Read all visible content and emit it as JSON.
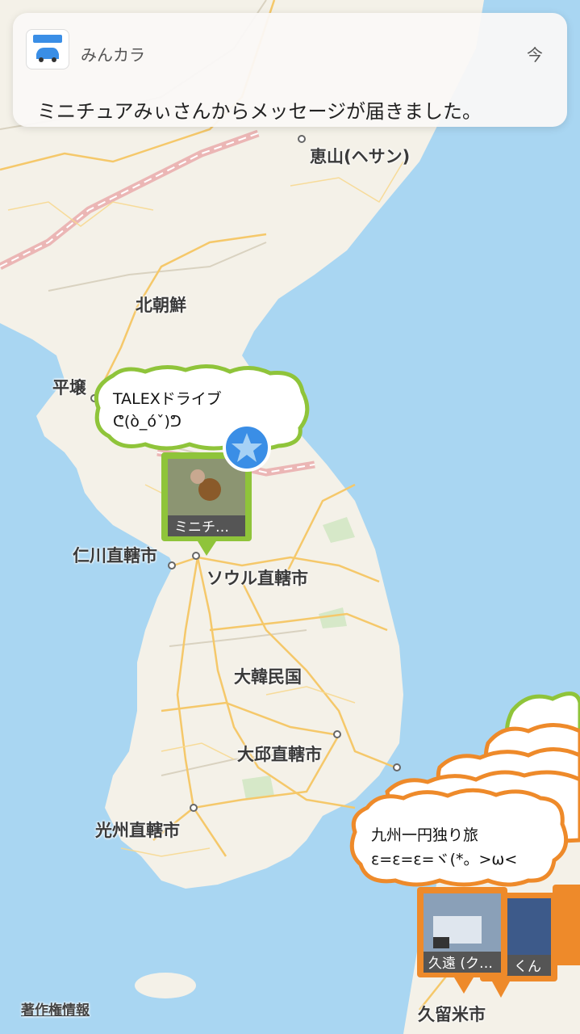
{
  "notification": {
    "app_name": "みんカラ",
    "time": "今",
    "message": "ミニチュアみぃさんからメッセージが届きました。"
  },
  "map": {
    "labels": {
      "hyesan": "恵山(ヘサン)",
      "north_korea": "北朝鮮",
      "pyongyang": "平壌",
      "incheon": "仁川直轄市",
      "seoul": "ソウル直轄市",
      "south_korea": "大韓民国",
      "daegu": "大邱直轄市",
      "gwangju": "光州直轄市",
      "kurume": "久留米市"
    },
    "colors": {
      "sea": "#a9d6f2",
      "land": "#f4f1e8",
      "road": "#f5c86a",
      "border": "#e8a0a0"
    }
  },
  "pins": [
    {
      "title": "TALEXドライブ",
      "subtitle": "ᕦ(ò_óˇ)ᕤ",
      "card_caption": "ミニチ…",
      "bubble_color": "#8fc43a",
      "favorite_icon": "star-icon"
    },
    {
      "title": "九州一円独り旅",
      "subtitle": "ε=ε=ε=ヾ(*。>ω<",
      "card_caption": "久遠 (ク…",
      "card_caption_behind": "くん",
      "bubble_color": "#ee8a2a"
    }
  ],
  "credit": "著作権情報"
}
